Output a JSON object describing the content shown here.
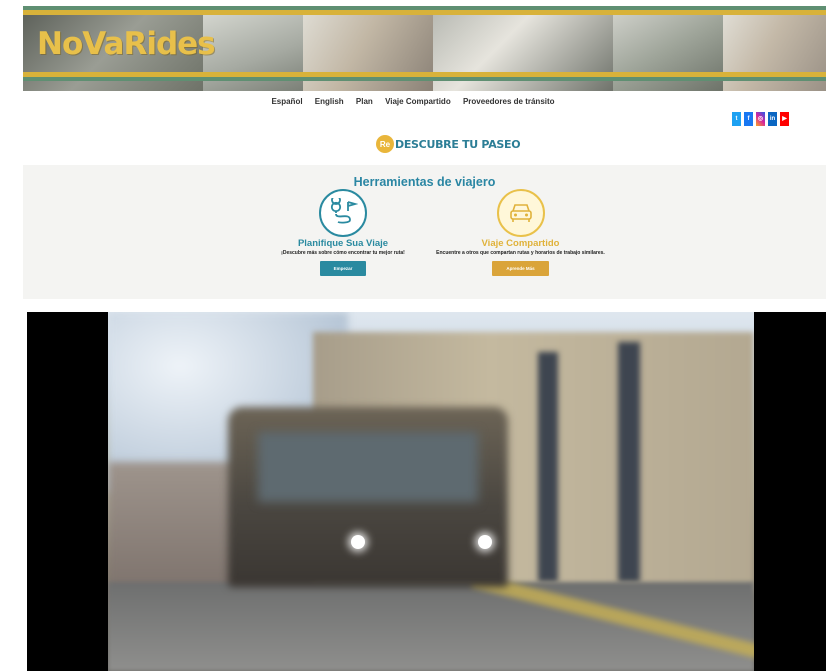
{
  "brand": {
    "logo_text": "NoVaRides"
  },
  "nav": {
    "items": [
      "Español",
      "English",
      "Plan",
      "Viaje Compartido",
      "Proveedores de tránsito"
    ]
  },
  "social": [
    {
      "icon": "twitter-icon",
      "glyph": "t",
      "color": "#1da1f2"
    },
    {
      "icon": "facebook-icon",
      "glyph": "f",
      "color": "#1877f2"
    },
    {
      "icon": "instagram-icon",
      "glyph": "◎",
      "color": "#d6249f"
    },
    {
      "icon": "linkedin-icon",
      "glyph": "in",
      "color": "#0a66c2"
    },
    {
      "icon": "youtube-icon",
      "glyph": "▶",
      "color": "#ff0000"
    }
  ],
  "tagline": {
    "badge": "Re",
    "text": "DESCUBRE TU PASEO"
  },
  "tools": {
    "title": "Herramientas de viajero",
    "plan": {
      "title": "Planifique Sua Viaje",
      "desc": "¡Descubre más sobre cómo encontrar tu mejor ruta!",
      "button": "Empezar"
    },
    "share": {
      "title": "Viaje Compartido",
      "desc": "Encuentre a otros que compartan rutas y horarios de trabajo similares.",
      "button": "Aprende Más"
    }
  },
  "colors": {
    "teal": "#2a8aa0",
    "gold": "#daa43a",
    "accent_yellow": "#e8c04a"
  }
}
